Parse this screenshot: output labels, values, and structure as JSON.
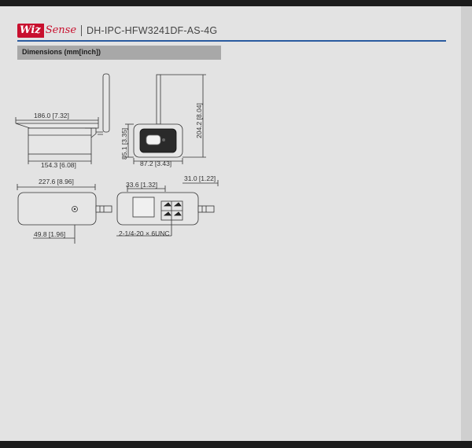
{
  "header": {
    "logo_part1": "Wiz",
    "logo_part2": "Sense",
    "model": "DH-IPC-HFW3241DF-AS-4G"
  },
  "section": {
    "title": "Dimensions (mm[inch])"
  },
  "dimensions": {
    "d1": "186.0 [7.32]",
    "d2": "154.3 [6.08]",
    "d3": "85.1 [3.35]",
    "d4": "87.2 [3.43]",
    "d5": "204.2 [8.04]",
    "d6": "227.6 [8.96]",
    "d7": "49.8 [1.96]",
    "d8": "33.6 [1.32]",
    "d9": "31.0 [1.22]",
    "d10": "2-1/4-20 × 6UNC"
  },
  "colors": {
    "brand_red": "#c8102e",
    "rule_blue": "#2a5ba0"
  }
}
